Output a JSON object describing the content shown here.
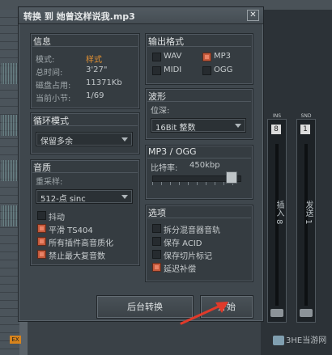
{
  "dialog": {
    "title": "转换 到 她曾这样说我.mp3",
    "close_glyph": "✕"
  },
  "info": {
    "title": "信息",
    "rows": [
      {
        "label": "模式:",
        "value": "样式"
      },
      {
        "label": "总时间:",
        "value": "3'27\""
      },
      {
        "label": "磁盘占用:",
        "value": "11371Kb"
      },
      {
        "label": "当前小节:",
        "value": "1/69"
      }
    ]
  },
  "loop_mode": {
    "title": "循环模式",
    "selected": "保留多余"
  },
  "quality": {
    "title": "音质",
    "resample_label": "重采样:",
    "resample_selected": "512-点 sinc",
    "options": [
      {
        "label": "抖动",
        "checked": false
      },
      {
        "label": "平滑 TS404",
        "checked": true
      },
      {
        "label": "所有插件高音质化",
        "checked": true
      },
      {
        "label": "禁止最大复音数",
        "checked": true
      }
    ]
  },
  "output_format": {
    "title": "输出格式",
    "formats": [
      {
        "label": "WAV",
        "checked": false
      },
      {
        "label": "MP3",
        "checked": true
      },
      {
        "label": "MIDI",
        "checked": false
      },
      {
        "label": "OGG",
        "checked": false
      }
    ]
  },
  "waveform": {
    "title": "波形",
    "depth_label": "位深:",
    "depth_selected": "16Bit 整数"
  },
  "mp3_ogg": {
    "title": "MP3 / OGG",
    "bitrate_label": "比特率:",
    "bitrate_value": "450kbp",
    "slider_fraction": 0.9
  },
  "options": {
    "title": "选项",
    "items": [
      {
        "label": "拆分混音器音轨",
        "checked": false
      },
      {
        "label": "保存 ACID",
        "checked": false
      },
      {
        "label": "保存切片标记",
        "checked": false
      },
      {
        "label": "延迟补偿",
        "checked": true
      }
    ]
  },
  "buttons": {
    "background": "后台转换",
    "start": "开始"
  },
  "mixer": {
    "ch1_header": "INS",
    "ch1_number": "8",
    "ch1_label": "插入 8",
    "ch2_header": "SND",
    "ch2_number": "1",
    "ch2_label": "发送 1",
    "fx": "EX"
  },
  "watermark": "3HE当游网",
  "colors": {
    "accent_checked": "#c55a3c",
    "mode_value": "#e59232"
  }
}
